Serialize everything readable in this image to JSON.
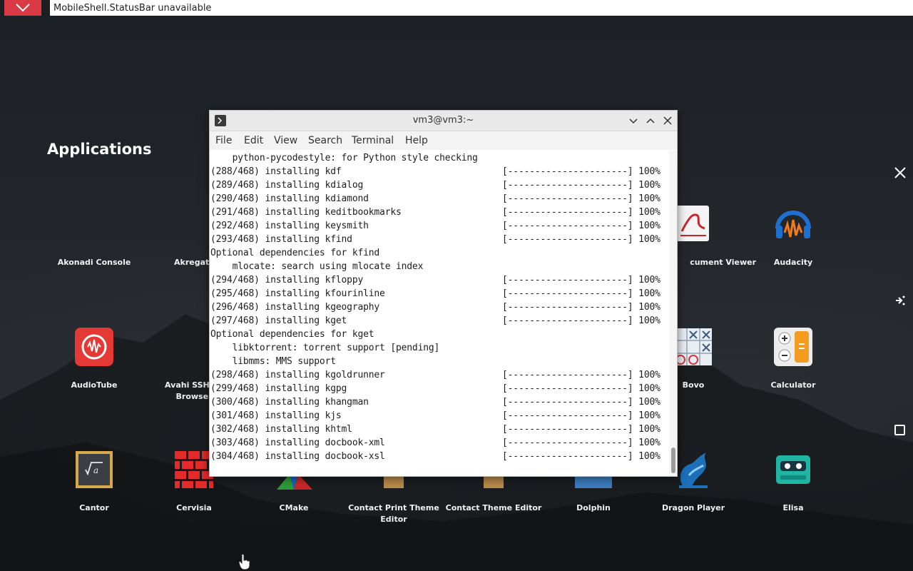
{
  "statusbar": {
    "message": "MobileShell.StatusBar unavailable"
  },
  "launcher": {
    "title": "Applications",
    "apps": [
      {
        "label": "Akonadi Console",
        "icon": "akonadi-console-icon"
      },
      {
        "label": "Akregato",
        "icon": "akregator-icon"
      },
      {
        "label": "cument Viewer",
        "icon": "document-viewer-icon"
      },
      {
        "label": "Audacity",
        "icon": "audacity-icon"
      },
      {
        "label": "AudioTube",
        "icon": "audiotube-icon"
      },
      {
        "label": "Avahi SSH Se",
        "label2": "Browser",
        "icon": "avahi-ssh-icon"
      },
      {
        "label": "Bovo",
        "icon": "bovo-icon"
      },
      {
        "label": "Calculator",
        "icon": "calculator-icon"
      },
      {
        "label": "Cantor",
        "icon": "cantor-icon"
      },
      {
        "label": "Cervisia",
        "icon": "cervisia-icon"
      },
      {
        "label": "CMake",
        "icon": "cmake-icon"
      },
      {
        "label": "Contact Print Theme",
        "label2": "Editor",
        "icon": "contact-print-theme-icon"
      },
      {
        "label": "Contact Theme Editor",
        "icon": "contact-theme-editor-icon"
      },
      {
        "label": "Dolphin",
        "icon": "dolphin-icon"
      },
      {
        "label": "Dragon Player",
        "icon": "dragon-player-icon"
      },
      {
        "label": "Elisa",
        "icon": "elisa-icon"
      }
    ]
  },
  "terminal": {
    "title": "vm3@vm3:~",
    "menu": [
      "File",
      "Edit",
      "View",
      "Search",
      "Terminal",
      "Help"
    ],
    "progress_bar": "[----------------------] 100%",
    "lines": [
      {
        "text": "    python-pycodestyle: for Python style checking",
        "bar": false
      },
      {
        "text": "(288/468) installing kdf",
        "bar": true
      },
      {
        "text": "(289/468) installing kdialog",
        "bar": true
      },
      {
        "text": "(290/468) installing kdiamond",
        "bar": true
      },
      {
        "text": "(291/468) installing keditbookmarks",
        "bar": true
      },
      {
        "text": "(292/468) installing keysmith",
        "bar": true
      },
      {
        "text": "(293/468) installing kfind",
        "bar": true
      },
      {
        "text": "Optional dependencies for kfind",
        "bar": false
      },
      {
        "text": "    mlocate: search using mlocate index",
        "bar": false
      },
      {
        "text": "(294/468) installing kfloppy",
        "bar": true
      },
      {
        "text": "(295/468) installing kfourinline",
        "bar": true
      },
      {
        "text": "(296/468) installing kgeography",
        "bar": true
      },
      {
        "text": "(297/468) installing kget",
        "bar": true
      },
      {
        "text": "Optional dependencies for kget",
        "bar": false
      },
      {
        "text": "    libktorrent: torrent support [pending]",
        "bar": false
      },
      {
        "text": "    libmms: MMS support",
        "bar": false
      },
      {
        "text": "(298/468) installing kgoldrunner",
        "bar": true
      },
      {
        "text": "(299/468) installing kgpg",
        "bar": true
      },
      {
        "text": "(300/468) installing khangman",
        "bar": true
      },
      {
        "text": "(301/468) installing kjs",
        "bar": true
      },
      {
        "text": "(302/468) installing khtml",
        "bar": true
      },
      {
        "text": "(303/468) installing docbook-xml",
        "bar": true
      },
      {
        "text": "(304/468) installing docbook-xsl",
        "bar": true
      }
    ]
  },
  "colors": {
    "close_red": "#d93a43",
    "term_bg": "#ffffff",
    "titlebar": "#e9e9e9"
  }
}
